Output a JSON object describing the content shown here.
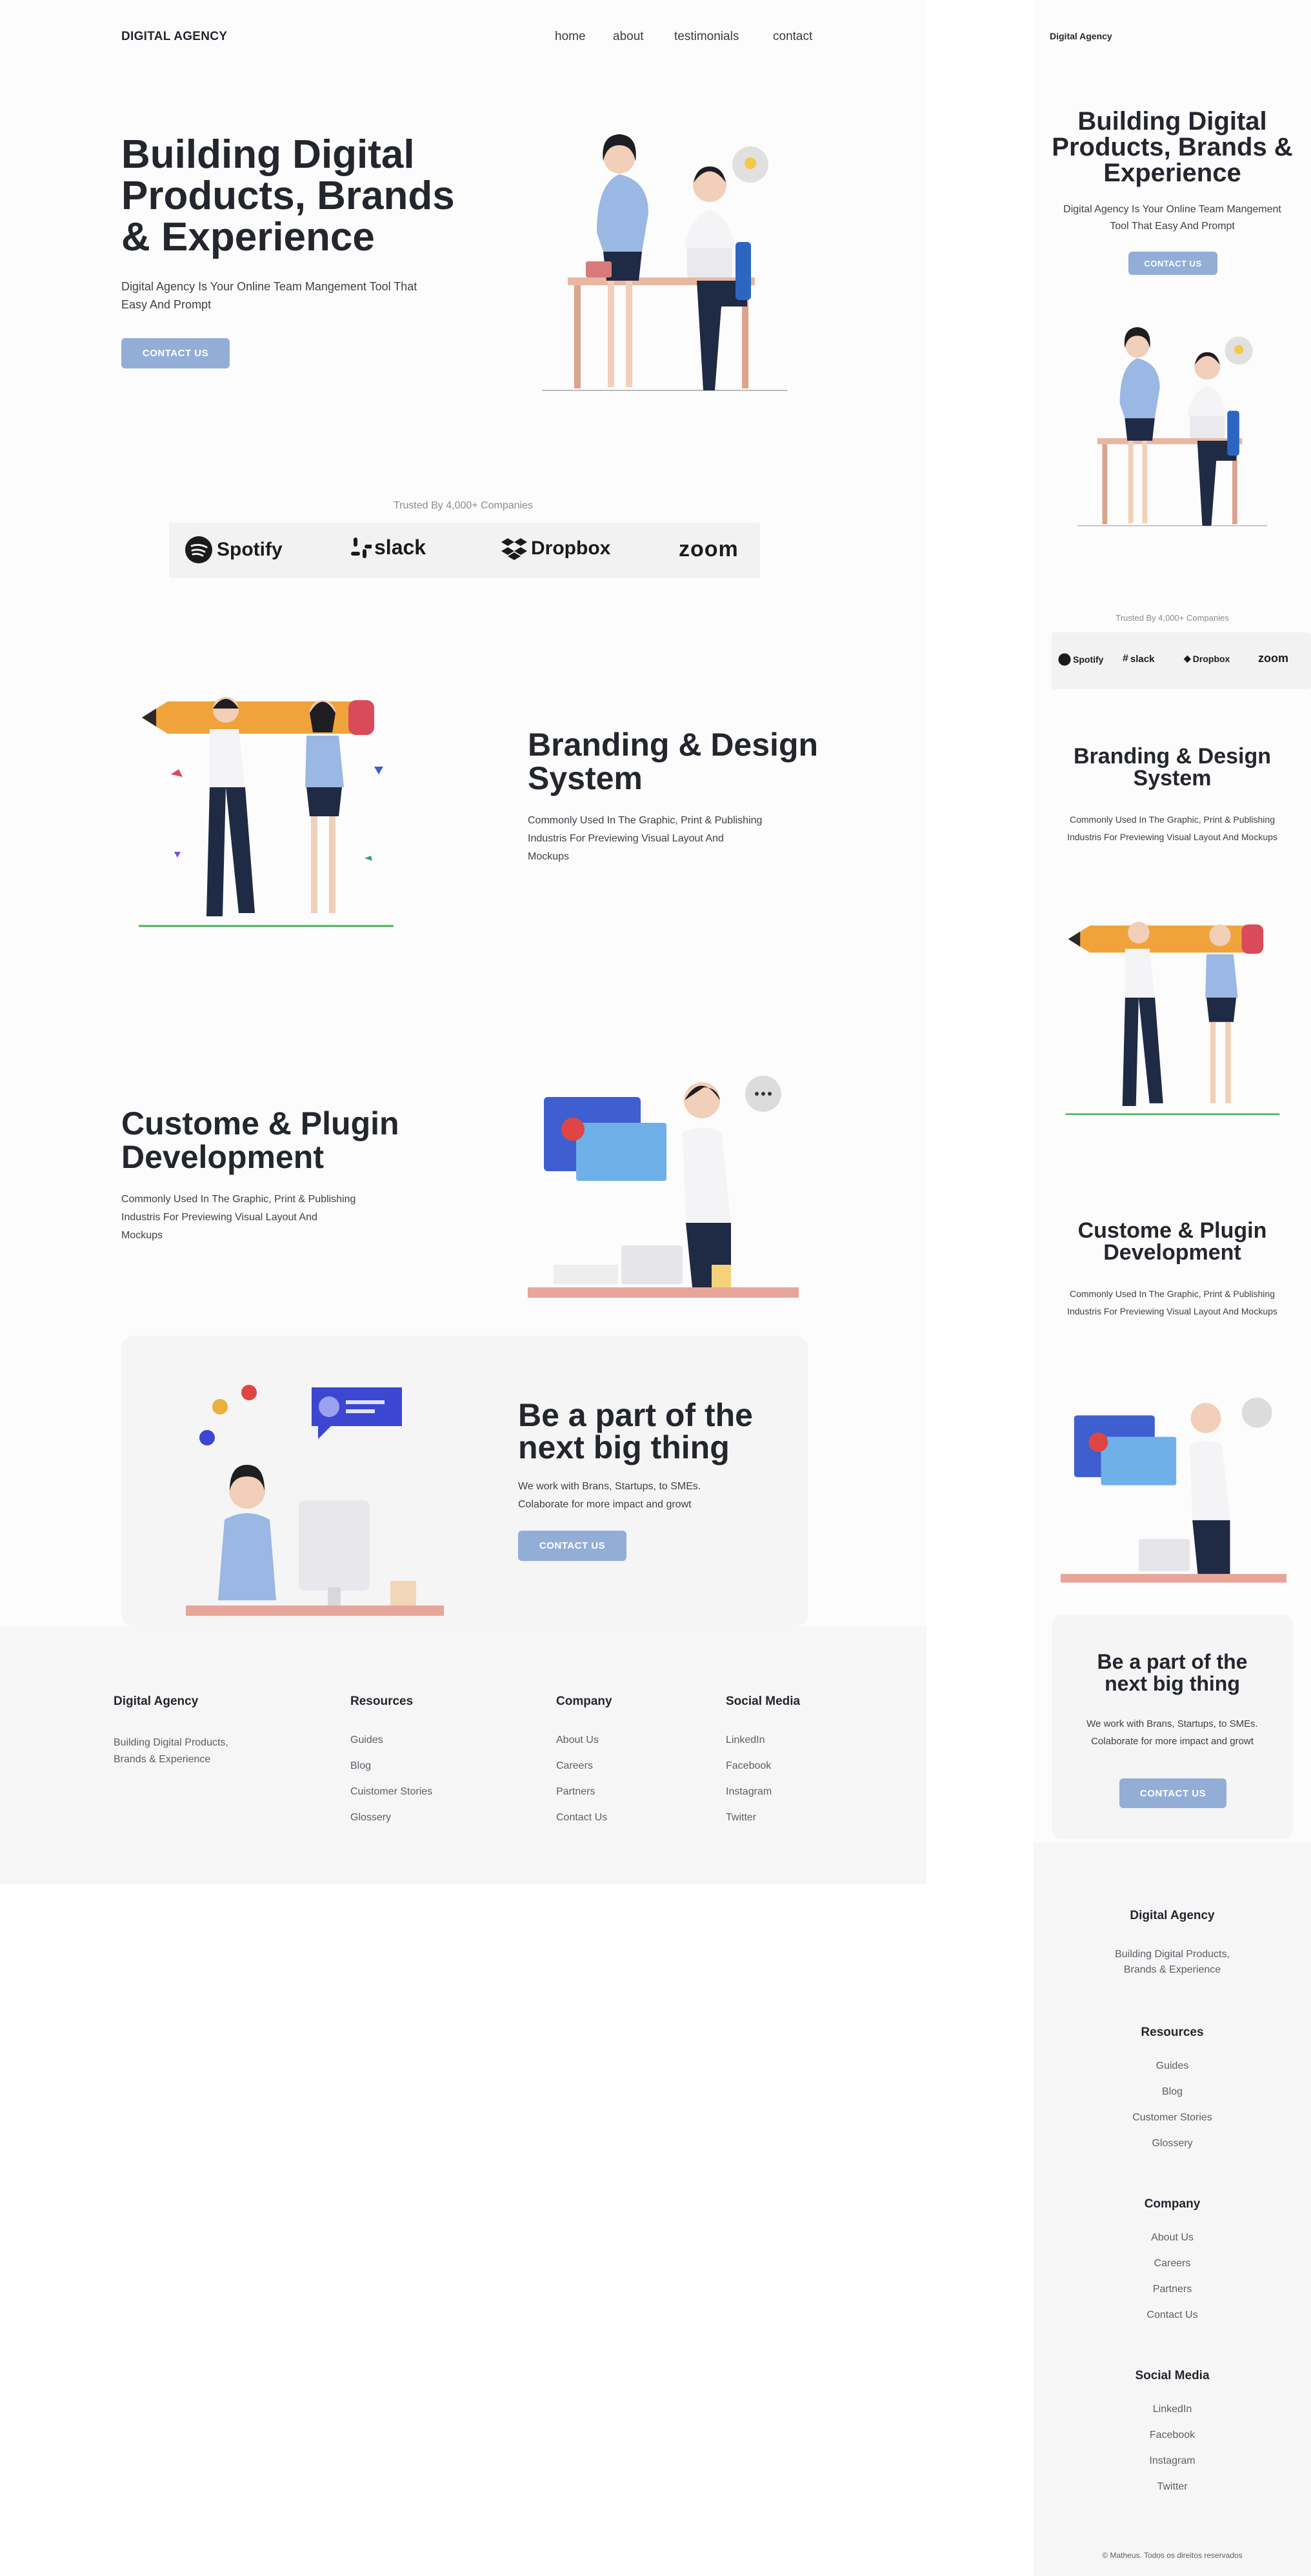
{
  "brand": {
    "name": "DIGITAL AGENCY",
    "mobile_name": "Digital Agency"
  },
  "nav": {
    "items": [
      "home",
      "about",
      "testimonials",
      "contact"
    ]
  },
  "hero": {
    "title_line1": "Building Digital",
    "title_line2": "Products, Brands",
    "title_line3": "& Experience",
    "subtitle_line1": "Digital Agency Is Your Online Team Mangement Tool That",
    "subtitle_line2": "Easy And Prompt",
    "cta": "CONTACT US"
  },
  "mobile_hero": {
    "title_line1": "Building Digital",
    "title_line2": "Products, Brands &",
    "title_line3": "Experience",
    "subtitle_line1": "Digital Agency Is Your Online Team Mangement",
    "subtitle_line2": "Tool That Easy And Prompt"
  },
  "trusted": {
    "label": "Trusted By 4,000+ Companies",
    "logos": [
      "Spotify",
      "slack",
      "Dropbox",
      "zoom"
    ]
  },
  "branding": {
    "title_line1": "Branding & Design",
    "title_line2": "System",
    "text_line1": "Commonly Used In The Graphic, Print & Publishing",
    "text_line2": "Industris For Previewing Visual Layout And",
    "text_line3": "Mockups"
  },
  "mobile_branding": {
    "text_line1": "Commonly Used In The Graphic, Print & Publishing",
    "text_line2": "Industris For Previewing Visual Layout And Mockups"
  },
  "plugin": {
    "title_line1": "Custome & Plugin",
    "title_line2": "Development",
    "text_line1": "Commonly Used In The Graphic, Print & Publishing",
    "text_line2": "Industris For Previewing Visual Layout And",
    "text_line3": "Mockups"
  },
  "cta_section": {
    "title_line1": "Be a part of the",
    "title_line2": "next big thing",
    "text_line1": "We work with Brans, Startups, to SMEs.",
    "text_line2": "Colaborate for more impact and growt",
    "button": "CONTACT US"
  },
  "footer": {
    "brand": "Digital Agency",
    "tagline_line1": "Building Digital Products,",
    "tagline_line2": "Brands & Experience",
    "columns": [
      {
        "title": "Resources",
        "links": [
          "Guides",
          "Blog",
          "Cuistomer Stories",
          "Glossery"
        ]
      },
      {
        "title": "Company",
        "links": [
          "About Us",
          "Careers",
          "Partners",
          "Contact Us"
        ]
      },
      {
        "title": "Social Media",
        "links": [
          "LinkedIn",
          "Facebook",
          "Instagram",
          "Twitter"
        ]
      }
    ],
    "mobile_resources_links": [
      "Guides",
      "Blog",
      "Customer Stories",
      "Glossery"
    ],
    "copyright": "© Matheus. Todos os direitos reservados"
  },
  "colors": {
    "accent": "#93aed6",
    "text": "#24262d",
    "footer_bg": "#f6f6f6",
    "card_bg": "#f5f5f5"
  }
}
